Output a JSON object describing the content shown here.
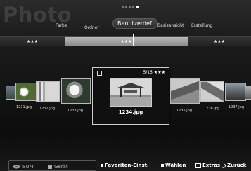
{
  "header": {
    "app_title": "Photo",
    "page_indicator": {
      "total": 5,
      "active": 5
    }
  },
  "sort_tabs": [
    {
      "label": "Farbe"
    },
    {
      "label": "Ordner"
    },
    {
      "label": "Benutzerdef.",
      "active": true
    },
    {
      "label": "Basisansicht"
    },
    {
      "label": "Erstellung"
    }
  ],
  "rating_bar": {
    "segments": [
      "★★★",
      "★★★",
      "★★★"
    ],
    "active_index": 1
  },
  "thumbnails": [
    {
      "name": "1231.jpg"
    },
    {
      "name": "1232.jpg"
    },
    {
      "name": "1233.jpg"
    },
    {
      "name": "1235.jpg"
    },
    {
      "name": "1236.jpg"
    },
    {
      "name": "1237.jpg"
    }
  ],
  "focused": {
    "name": "1234.jpg",
    "counter": "5/15",
    "rating": "★★★"
  },
  "footer": {
    "sum_label": "SUM",
    "device_label": "Gerät",
    "favorites_label": "Favoriten-Einst.",
    "select_label": "Wählen",
    "extras_label": "Extras",
    "back_label": "Zurück"
  }
}
